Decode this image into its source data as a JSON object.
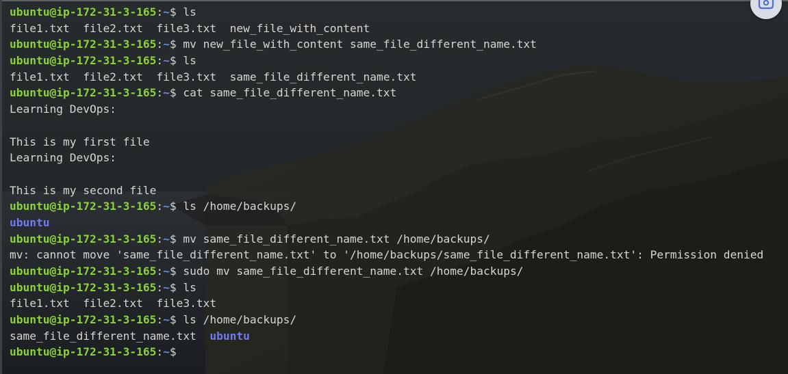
{
  "prompt": {
    "user_host": "ubuntu@ip-172-31-3-165",
    "colon": ":",
    "cwd": "~",
    "dollar": "$"
  },
  "lines": [
    {
      "type": "cmd",
      "cmd": " ls"
    },
    {
      "type": "out",
      "text": "file1.txt  file2.txt  file3.txt  new_file_with_content"
    },
    {
      "type": "cmd",
      "cmd": " mv new_file_with_content same_file_different_name.txt"
    },
    {
      "type": "cmd",
      "cmd": " ls"
    },
    {
      "type": "out",
      "text": "file1.txt  file2.txt  file3.txt  same_file_different_name.txt"
    },
    {
      "type": "cmd",
      "cmd": " cat same_file_different_name.txt"
    },
    {
      "type": "out",
      "text": "Learning DevOps:"
    },
    {
      "type": "out",
      "text": ""
    },
    {
      "type": "out",
      "text": "This is my first file"
    },
    {
      "type": "out",
      "text": "Learning DevOps:"
    },
    {
      "type": "out",
      "text": ""
    },
    {
      "type": "out",
      "text": "This is my second file"
    },
    {
      "type": "cmd",
      "cmd": " ls /home/backups/"
    },
    {
      "type": "dir",
      "text": "ubuntu"
    },
    {
      "type": "cmd",
      "cmd": " mv same_file_different_name.txt /home/backups/"
    },
    {
      "type": "out",
      "text": "mv: cannot move 'same_file_different_name.txt' to '/home/backups/same_file_different_name.txt': Permission denied"
    },
    {
      "type": "cmd",
      "cmd": " sudo mv same_file_different_name.txt /home/backups/"
    },
    {
      "type": "cmd",
      "cmd": " ls"
    },
    {
      "type": "out",
      "text": "file1.txt  file2.txt  file3.txt"
    },
    {
      "type": "cmd",
      "cmd": " ls /home/backups/"
    },
    {
      "type": "mixed",
      "text": "same_file_different_name.txt  ",
      "dir": "ubuntu"
    },
    {
      "type": "cmd",
      "cmd": ""
    }
  ],
  "icons": {
    "screenshot": "camera-capture-icon"
  },
  "colors": {
    "prompt_user_host": "#8cd33a",
    "prompt_cwd": "#6b8ad8",
    "directory": "#6f7bf0",
    "text": "#d6d6d2"
  }
}
